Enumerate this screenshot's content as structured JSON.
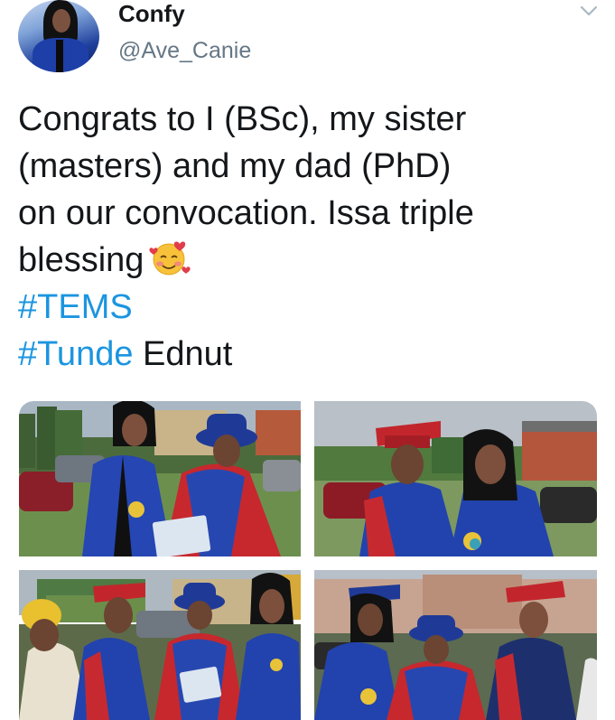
{
  "tweet": {
    "author": {
      "display_name": "Confy",
      "handle": "@Ave_Canie"
    },
    "menu_icon": "chevron-down-icon",
    "text_lines": [
      "Congrats to I (BSc), my sister",
      "(masters) and my dad (PhD)",
      "on our convocation. Issa triple",
      "blessing"
    ],
    "emoji": "smiling-face-with-hearts",
    "hashtags": [
      "#TEMS",
      "#Tunde"
    ],
    "after_hashtag_text": " Ednut",
    "media": {
      "count": 4,
      "photos": [
        "graduation-photo",
        "graduation-photo",
        "graduation-photo",
        "graduation-photo"
      ]
    }
  },
  "colors": {
    "text": "#14171a",
    "secondary": "#657786",
    "link": "#1b95e0",
    "gown_blue": "#1f3fa6",
    "gown_red": "#c8202a"
  }
}
